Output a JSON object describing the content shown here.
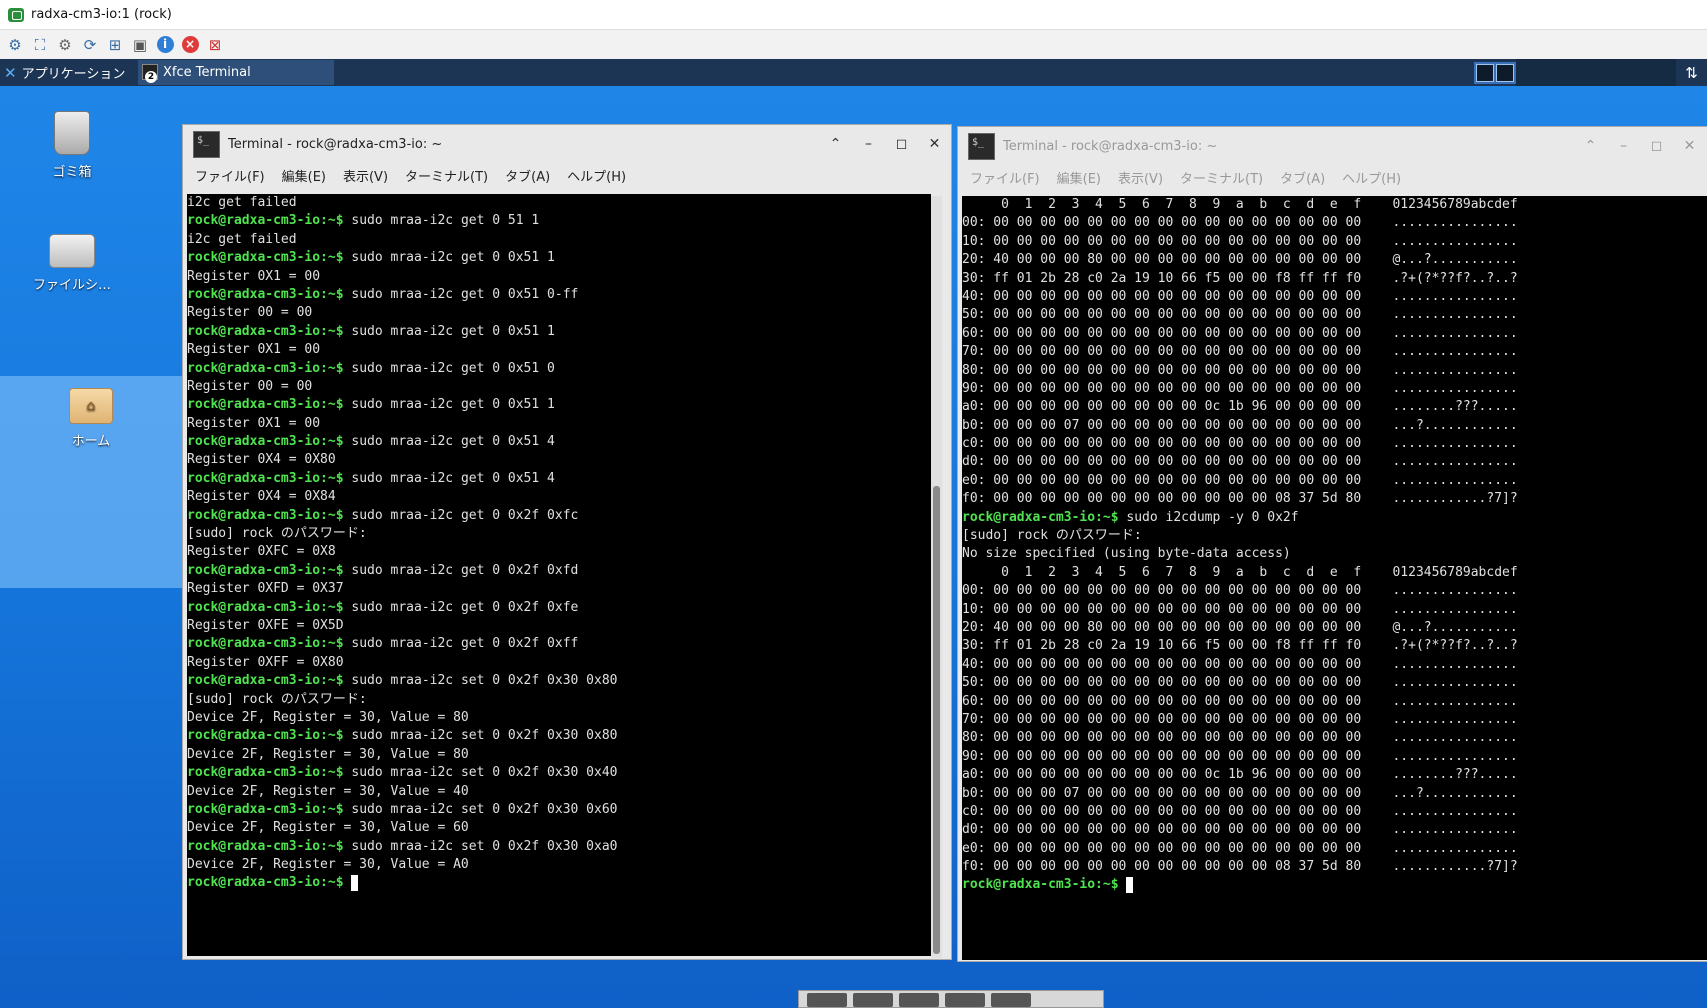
{
  "viewer": {
    "title": "radxa-cm3-io:1 (rock)"
  },
  "toolbar_icons": [
    "options-icon",
    "fullscreen-icon",
    "settings-icon",
    "refresh-icon",
    "windows-key-icon",
    "clipboard-icon",
    "info-icon",
    "close-icon",
    "transfer-icon"
  ],
  "panel": {
    "apps_label": "アプリケーション",
    "task_label": "Xfce Terminal",
    "task_badge": "2"
  },
  "desktop_icons": {
    "trash": "ゴミ箱",
    "files": "ファイルシ…",
    "home": "ホーム"
  },
  "term1": {
    "title": "Terminal - rock@radxa-cm3-io: ~",
    "menu": [
      "ファイル(F)",
      "編集(E)",
      "表示(V)",
      "ターミナル(T)",
      "タブ(A)",
      "ヘルプ(H)"
    ],
    "lines": [
      {
        "t": "i2c get failed"
      },
      {
        "p": "rock@radxa-cm3-io:~$",
        "t": " sudo mraa-i2c get 0 51 1"
      },
      {
        "t": "i2c get failed"
      },
      {
        "p": "rock@radxa-cm3-io:~$",
        "t": " sudo mraa-i2c get 0 0x51 1"
      },
      {
        "t": "Register 0X1 = 00"
      },
      {
        "p": "rock@radxa-cm3-io:~$",
        "t": " sudo mraa-i2c get 0 0x51 0-ff"
      },
      {
        "t": "Register 00 = 00"
      },
      {
        "p": "rock@radxa-cm3-io:~$",
        "t": " sudo mraa-i2c get 0 0x51 1"
      },
      {
        "t": "Register 0X1 = 00"
      },
      {
        "p": "rock@radxa-cm3-io:~$",
        "t": " sudo mraa-i2c get 0 0x51 0"
      },
      {
        "t": "Register 00 = 00"
      },
      {
        "p": "rock@radxa-cm3-io:~$",
        "t": " sudo mraa-i2c get 0 0x51 1"
      },
      {
        "t": "Register 0X1 = 00"
      },
      {
        "p": "rock@radxa-cm3-io:~$",
        "t": " sudo mraa-i2c get 0 0x51 4"
      },
      {
        "t": "Register 0X4 = 0X80"
      },
      {
        "p": "rock@radxa-cm3-io:~$",
        "t": " sudo mraa-i2c get 0 0x51 4"
      },
      {
        "t": "Register 0X4 = 0X84"
      },
      {
        "p": "rock@radxa-cm3-io:~$",
        "t": " sudo mraa-i2c get 0 0x2f 0xfc"
      },
      {
        "t": "[sudo] rock のパスワード:"
      },
      {
        "t": "Register 0XFC = 0X8"
      },
      {
        "p": "rock@radxa-cm3-io:~$",
        "t": " sudo mraa-i2c get 0 0x2f 0xfd"
      },
      {
        "t": "Register 0XFD = 0X37"
      },
      {
        "p": "rock@radxa-cm3-io:~$",
        "t": " sudo mraa-i2c get 0 0x2f 0xfe"
      },
      {
        "t": "Register 0XFE = 0X5D"
      },
      {
        "p": "rock@radxa-cm3-io:~$",
        "t": " sudo mraa-i2c get 0 0x2f 0xff"
      },
      {
        "t": "Register 0XFF = 0X80"
      },
      {
        "p": "rock@radxa-cm3-io:~$",
        "t": " sudo mraa-i2c set 0 0x2f 0x30 0x80"
      },
      {
        "t": "[sudo] rock のパスワード:"
      },
      {
        "t": "Device 2F, Register = 30, Value = 80"
      },
      {
        "p": "rock@radxa-cm3-io:~$",
        "t": " sudo mraa-i2c set 0 0x2f 0x30 0x80"
      },
      {
        "t": "Device 2F, Register = 30, Value = 80"
      },
      {
        "p": "rock@radxa-cm3-io:~$",
        "t": " sudo mraa-i2c set 0 0x2f 0x30 0x40"
      },
      {
        "t": "Device 2F, Register = 30, Value = 40"
      },
      {
        "p": "rock@radxa-cm3-io:~$",
        "t": " sudo mraa-i2c set 0 0x2f 0x30 0x60"
      },
      {
        "t": "Device 2F, Register = 30, Value = 60"
      },
      {
        "p": "rock@radxa-cm3-io:~$",
        "t": " sudo mraa-i2c set 0 0x2f 0x30 0xa0"
      },
      {
        "t": "Device 2F, Register = 30, Value = A0"
      },
      {
        "p": "rock@radxa-cm3-io:~$",
        "t": " ",
        "cursor": true
      }
    ]
  },
  "term2": {
    "title": "Terminal - rock@radxa-cm3-io: ~",
    "menu": [
      "ファイル(F)",
      "編集(E)",
      "表示(V)",
      "ターミナル(T)",
      "タブ(A)",
      "ヘルプ(H)"
    ],
    "lines": [
      {
        "t": "     0  1  2  3  4  5  6  7  8  9  a  b  c  d  e  f    0123456789abcdef"
      },
      {
        "t": "00: 00 00 00 00 00 00 00 00 00 00 00 00 00 00 00 00    ................"
      },
      {
        "t": "10: 00 00 00 00 00 00 00 00 00 00 00 00 00 00 00 00    ................"
      },
      {
        "t": "20: 40 00 00 00 80 00 00 00 00 00 00 00 00 00 00 00    @...?..........."
      },
      {
        "t": "30: ff 01 2b 28 c0 2a 19 10 66 f5 00 00 f8 ff ff f0    .?+(?*??f?..?..?"
      },
      {
        "t": "40: 00 00 00 00 00 00 00 00 00 00 00 00 00 00 00 00    ................"
      },
      {
        "t": "50: 00 00 00 00 00 00 00 00 00 00 00 00 00 00 00 00    ................"
      },
      {
        "t": "60: 00 00 00 00 00 00 00 00 00 00 00 00 00 00 00 00    ................"
      },
      {
        "t": "70: 00 00 00 00 00 00 00 00 00 00 00 00 00 00 00 00    ................"
      },
      {
        "t": "80: 00 00 00 00 00 00 00 00 00 00 00 00 00 00 00 00    ................"
      },
      {
        "t": "90: 00 00 00 00 00 00 00 00 00 00 00 00 00 00 00 00    ................"
      },
      {
        "t": "a0: 00 00 00 00 00 00 00 00 00 0c 1b 96 00 00 00 00    ........???....."
      },
      {
        "t": "b0: 00 00 00 07 00 00 00 00 00 00 00 00 00 00 00 00    ...?............"
      },
      {
        "t": "c0: 00 00 00 00 00 00 00 00 00 00 00 00 00 00 00 00    ................"
      },
      {
        "t": "d0: 00 00 00 00 00 00 00 00 00 00 00 00 00 00 00 00    ................"
      },
      {
        "t": "e0: 00 00 00 00 00 00 00 00 00 00 00 00 00 00 00 00    ................"
      },
      {
        "t": "f0: 00 00 00 00 00 00 00 00 00 00 00 00 08 37 5d 80    ............?7]?"
      },
      {
        "p": "rock@radxa-cm3-io:~$",
        "t": " sudo i2cdump -y 0 0x2f"
      },
      {
        "t": "[sudo] rock のパスワード:"
      },
      {
        "t": "No size specified (using byte-data access)"
      },
      {
        "t": "     0  1  2  3  4  5  6  7  8  9  a  b  c  d  e  f    0123456789abcdef"
      },
      {
        "t": "00: 00 00 00 00 00 00 00 00 00 00 00 00 00 00 00 00    ................"
      },
      {
        "t": "10: 00 00 00 00 00 00 00 00 00 00 00 00 00 00 00 00    ................"
      },
      {
        "t": "20: 40 00 00 00 80 00 00 00 00 00 00 00 00 00 00 00    @...?..........."
      },
      {
        "t": "30: ff 01 2b 28 c0 2a 19 10 66 f5 00 00 f8 ff ff f0    .?+(?*??f?..?..?"
      },
      {
        "t": "40: 00 00 00 00 00 00 00 00 00 00 00 00 00 00 00 00    ................"
      },
      {
        "t": "50: 00 00 00 00 00 00 00 00 00 00 00 00 00 00 00 00    ................"
      },
      {
        "t": "60: 00 00 00 00 00 00 00 00 00 00 00 00 00 00 00 00    ................"
      },
      {
        "t": "70: 00 00 00 00 00 00 00 00 00 00 00 00 00 00 00 00    ................"
      },
      {
        "t": "80: 00 00 00 00 00 00 00 00 00 00 00 00 00 00 00 00    ................"
      },
      {
        "t": "90: 00 00 00 00 00 00 00 00 00 00 00 00 00 00 00 00    ................"
      },
      {
        "t": "a0: 00 00 00 00 00 00 00 00 00 0c 1b 96 00 00 00 00    ........???....."
      },
      {
        "t": "b0: 00 00 00 07 00 00 00 00 00 00 00 00 00 00 00 00    ...?............"
      },
      {
        "t": "c0: 00 00 00 00 00 00 00 00 00 00 00 00 00 00 00 00    ................"
      },
      {
        "t": "d0: 00 00 00 00 00 00 00 00 00 00 00 00 00 00 00 00    ................"
      },
      {
        "t": "e0: 00 00 00 00 00 00 00 00 00 00 00 00 00 00 00 00    ................"
      },
      {
        "t": "f0: 00 00 00 00 00 00 00 00 00 00 00 00 08 37 5d 80    ............?7]?"
      },
      {
        "p": "rock@radxa-cm3-io:~$",
        "t": " ",
        "cursor": true
      }
    ]
  }
}
